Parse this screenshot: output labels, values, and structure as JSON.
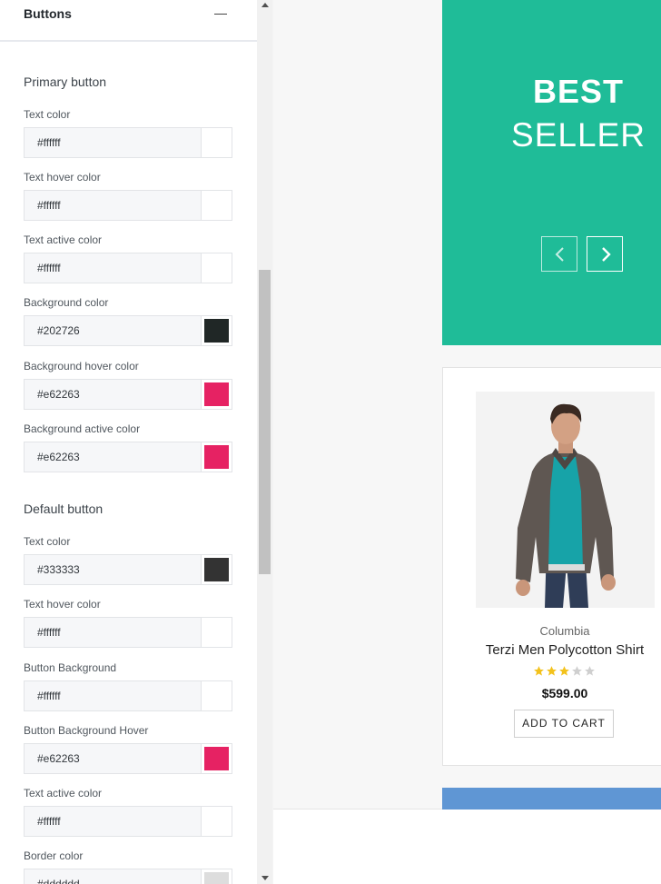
{
  "panel": {
    "title": "Buttons",
    "primary": {
      "heading": "Primary button",
      "fields": [
        {
          "label": "Text color",
          "value": "#ffffff",
          "swatch": "#ffffff"
        },
        {
          "label": "Text hover color",
          "value": "#ffffff",
          "swatch": "#ffffff"
        },
        {
          "label": "Text active color",
          "value": "#ffffff",
          "swatch": "#ffffff"
        },
        {
          "label": "Background color",
          "value": "#202726",
          "swatch": "#202726"
        },
        {
          "label": "Background hover color",
          "value": "#e62263",
          "swatch": "#e62263"
        },
        {
          "label": "Background active color",
          "value": "#e62263",
          "swatch": "#e62263"
        }
      ]
    },
    "default": {
      "heading": "Default button",
      "fields": [
        {
          "label": "Text color",
          "value": "#333333",
          "swatch": "#333333"
        },
        {
          "label": "Text hover color",
          "value": "#ffffff",
          "swatch": "#ffffff"
        },
        {
          "label": "Button Background",
          "value": "#ffffff",
          "swatch": "#ffffff"
        },
        {
          "label": "Button Background Hover",
          "value": "#e62263",
          "swatch": "#e62263"
        },
        {
          "label": "Text active color",
          "value": "#ffffff",
          "swatch": "#ffffff"
        },
        {
          "label": "Border color",
          "value": "#dddddd",
          "swatch": "#dddddd"
        }
      ]
    }
  },
  "preview": {
    "banner": {
      "line1": "BEST",
      "line2": "SELLER",
      "color": "#1fbc98"
    },
    "product": {
      "brand": "Columbia",
      "name": "Terzi Men Polycotton Shirt",
      "rating": 3,
      "rating_max": 5,
      "price": "$599.00",
      "cta": "ADD TO CART"
    }
  }
}
